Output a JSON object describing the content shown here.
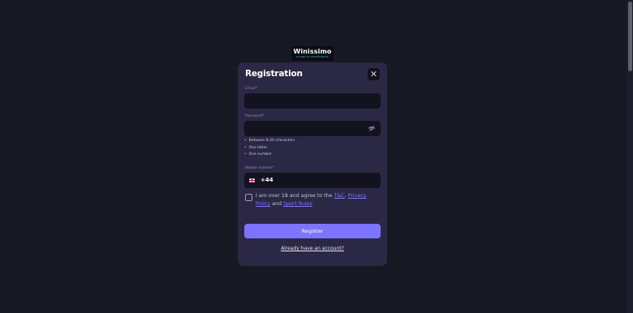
{
  "brand": {
    "name": "Winissimo",
    "tagline": "CASINO & SPORTSBOOK"
  },
  "modal": {
    "title": "Registration",
    "close_symbol": "✕",
    "email": {
      "label": "Email*",
      "value": ""
    },
    "password": {
      "label": "Password*",
      "value": "",
      "rules": [
        "Between 8-20 characters",
        "One letter",
        "One number"
      ]
    },
    "mobile": {
      "label": "Mobile number*",
      "dial_code": "+44",
      "value": ""
    },
    "consent": {
      "text_before": "I am over 18 and agree to the ",
      "tc_link": "T&C",
      "comma": ", ",
      "privacy_link": "Privacy Policy",
      "and": " and ",
      "sport_rules_link": "Sport Rules"
    },
    "register_label": "Register",
    "already_account_label": "Already have an account?"
  },
  "colors": {
    "background": "#161824",
    "modal": "#2a2845",
    "input": "#13131f",
    "accent": "#7c73fe"
  },
  "icons": {
    "close": "close-icon",
    "password_toggle": "eye-icon",
    "country": "uk-flag-icon"
  }
}
